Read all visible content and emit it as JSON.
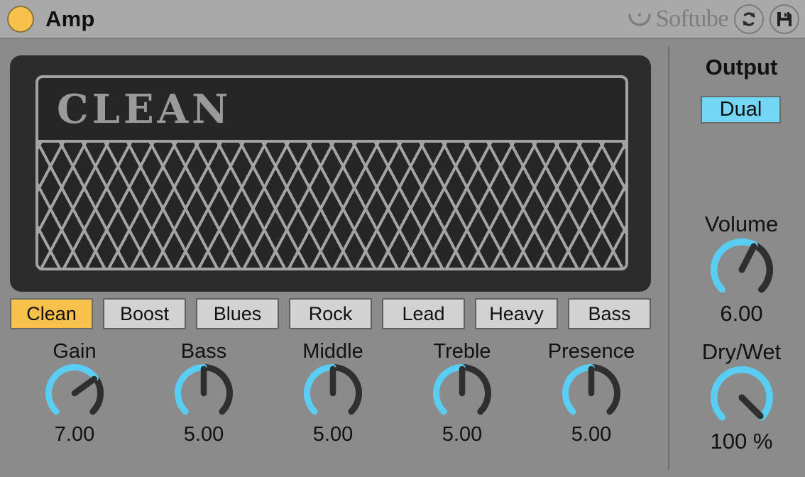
{
  "titlebar": {
    "power_icon": "power-toggle-circle",
    "title": "Amp",
    "brand": "Softube",
    "brand_mark_icon": "softube-smile-icon",
    "reload_icon": "refresh-sync-icon",
    "save_icon": "floppy-save-icon"
  },
  "cabinet": {
    "model_name": "CLEAN",
    "grille_icon": "diamond-lattice-grille"
  },
  "presets": {
    "selected": "Clean",
    "items": [
      {
        "label": "Clean",
        "active": true
      },
      {
        "label": "Boost",
        "active": false
      },
      {
        "label": "Blues",
        "active": false
      },
      {
        "label": "Rock",
        "active": false
      },
      {
        "label": "Lead",
        "active": false
      },
      {
        "label": "Heavy",
        "active": false
      },
      {
        "label": "Bass",
        "active": false
      }
    ]
  },
  "knobs": [
    {
      "label": "Gain",
      "value": "7.00",
      "amount": 0.7
    },
    {
      "label": "Bass",
      "value": "5.00",
      "amount": 0.5
    },
    {
      "label": "Middle",
      "value": "5.00",
      "amount": 0.5
    },
    {
      "label": "Treble",
      "value": "5.00",
      "amount": 0.5
    },
    {
      "label": "Presence",
      "value": "5.00",
      "amount": 0.5
    }
  ],
  "output": {
    "label": "Output",
    "mode": "Dual"
  },
  "volume": {
    "label": "Volume",
    "value": "6.00",
    "amount": 0.6
  },
  "drywet": {
    "label": "Dry/Wet",
    "value": "100 %",
    "amount": 1.0
  },
  "colors": {
    "accent_cyan": "#59cdf2",
    "accent_amber": "#f7c14b",
    "knob_track": "#2f2f2f",
    "panel_dark": "#2c2c2c",
    "background": "#8b8b8b",
    "titlebar": "#a9a9a9"
  }
}
